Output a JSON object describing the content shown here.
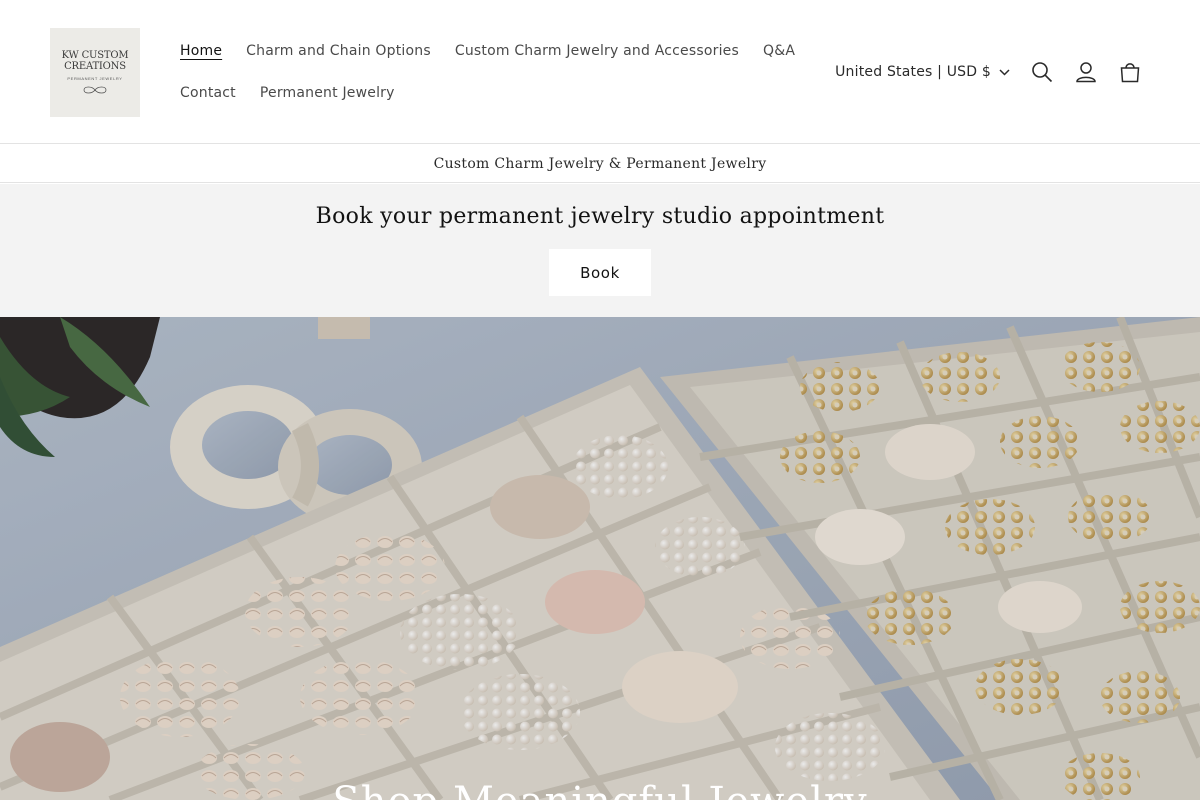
{
  "brand": {
    "logo_text_line1": "KW CUSTOM",
    "logo_text_line2": "CREATIONS",
    "logo_text_sub": "PERMANENT JEWELRY"
  },
  "nav": {
    "row1": [
      "Home",
      "Charm and Chain Options",
      "Custom Charm Jewelry and Accessories",
      "Q&A"
    ],
    "row2": [
      "Contact",
      "Permanent Jewelry"
    ],
    "active": "Home"
  },
  "header": {
    "locale_label": "United States | USD $",
    "icons": [
      "search-icon",
      "account-icon",
      "cart-icon",
      "chevron-down-icon"
    ]
  },
  "announcement": {
    "text": "Custom Charm Jewelry & Permanent Jewelry"
  },
  "booking": {
    "title": "Book your permanent jewelry studio appointment",
    "button_label": "Book"
  },
  "hero": {
    "heading": "Shop Meaningful Jewelry"
  },
  "colors": {
    "text": "#121212",
    "banner_bg": "#f3f3f3",
    "tray": "#d9d5cc",
    "backdrop": "#a9b4c4"
  }
}
